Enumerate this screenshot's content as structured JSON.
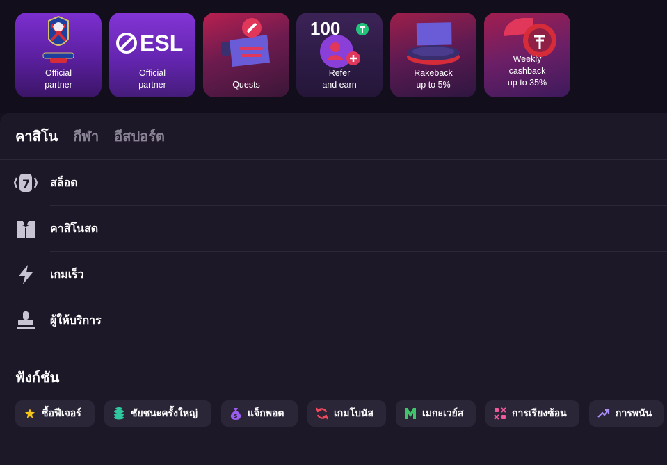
{
  "promos": [
    {
      "line1": "Official",
      "line2": "partner",
      "art": "crystal-palace-crest-icon"
    },
    {
      "line1": "Official",
      "line2": "partner",
      "art": "esl-logo",
      "logo_text": "ESL"
    },
    {
      "line1": "Quests",
      "line2": "",
      "art": "quest-scroll-icon"
    },
    {
      "line1": "Refer",
      "line2": "and earn",
      "art": "referral-icon",
      "badge_text": "100"
    },
    {
      "line1": "Rakeback",
      "line2": "up to 5%",
      "art": "rakeback-chips-icon"
    },
    {
      "line1": "Weekly",
      "line2": "cashback",
      "line3": "up to 35%",
      "art": "cashback-coin-icon"
    }
  ],
  "tabs": [
    "คาสิโน",
    "กีฬา",
    "อีสปอร์ต"
  ],
  "active_tab": "คาสิโน",
  "menu": [
    {
      "label": "สล็อต",
      "icon": "slot-machine-icon"
    },
    {
      "label": "คาสิโนสด",
      "icon": "tuxedo-icon"
    },
    {
      "label": "เกมเร็ว",
      "icon": "lightning-icon"
    },
    {
      "label": "ผู้ให้บริการ",
      "icon": "provider-stamp-icon"
    }
  ],
  "features": {
    "title": "ฟังก์ชัน",
    "chips": [
      {
        "label": "ซื้อฟีเจอร์",
        "icon": "star-icon",
        "color": "#f5c518"
      },
      {
        "label": "ชัยชนะครั้งใหญ่",
        "icon": "coin-stack-icon",
        "color": "#2fc9a0"
      },
      {
        "label": "แจ็กพอต",
        "icon": "money-bag-icon",
        "color": "#9b5cf0"
      },
      {
        "label": "เกมโบนัส",
        "icon": "refresh-icon",
        "color": "#f04a5a"
      },
      {
        "label": "เมกะเวย์ส",
        "icon": "megaways-icon",
        "color": "#3fc46a"
      },
      {
        "label": "การเรียงซ้อน",
        "icon": "cascade-icon",
        "color": "#f05a9a"
      },
      {
        "label": "การพนัน",
        "icon": "trend-up-icon",
        "color": "#a98cf5"
      }
    ]
  },
  "colors": {
    "background": "#120e1b",
    "panel": "#1d1828",
    "chip_bg": "#2b2538",
    "muted_text": "#8a8496",
    "accent_green": "#21c37a"
  }
}
